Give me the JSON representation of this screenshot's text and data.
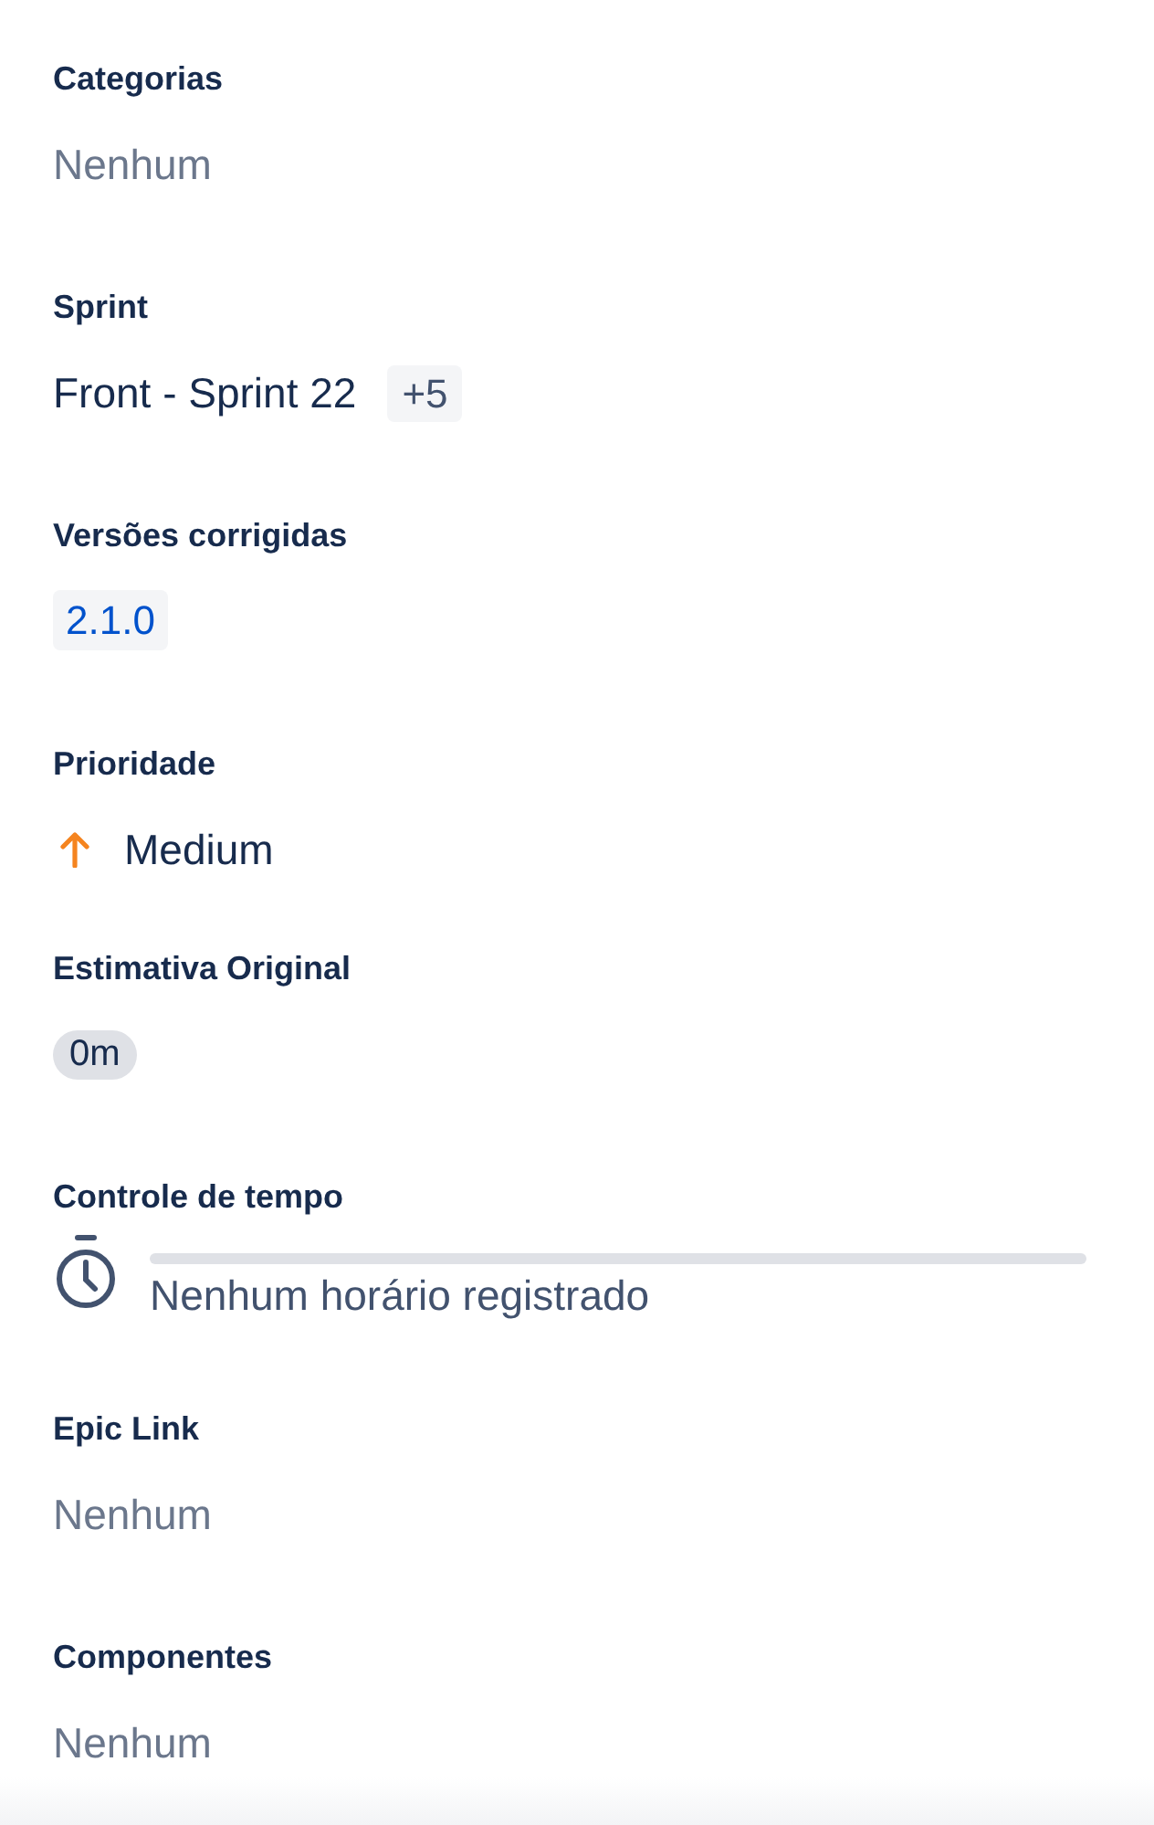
{
  "fields": [
    {
      "label": "Categorias",
      "kind": "empty",
      "value": "Nenhum"
    },
    {
      "label": "Sprint",
      "kind": "sprint",
      "value": "Front - Sprint 22",
      "more": "+5"
    },
    {
      "label": "Versões corrigidas",
      "kind": "versions",
      "versions": [
        "2.1.0"
      ]
    },
    {
      "label": "Prioridade",
      "kind": "priority",
      "value": "Medium"
    },
    {
      "label": "Estimativa Original",
      "kind": "estimate",
      "value": "0m"
    },
    {
      "label": "Controle de tempo",
      "kind": "time_tracking",
      "level": 0,
      "value": "Nenhum horário registrado"
    },
    {
      "label": "Epic Link",
      "kind": "empty",
      "value": "Nenhum"
    },
    {
      "label": "Componentes",
      "kind": "empty",
      "value": "Nenhum"
    }
  ]
}
